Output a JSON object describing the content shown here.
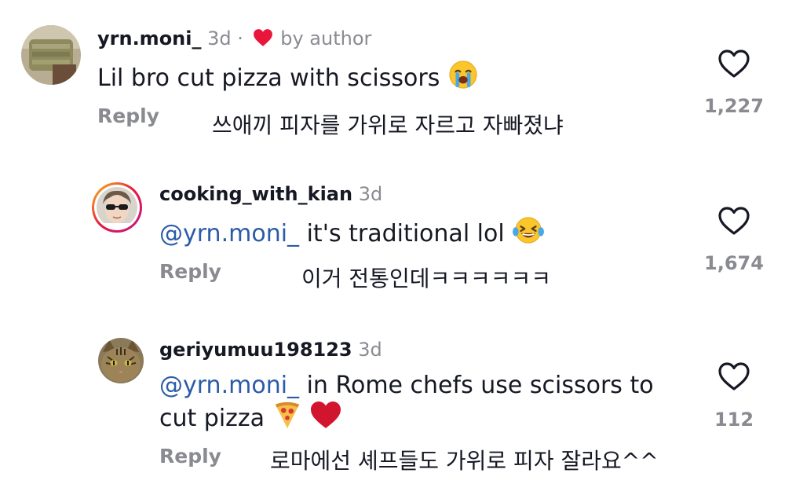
{
  "comments": [
    {
      "username": "yrn.moni_",
      "time": "3d",
      "separator": "·",
      "badge": "by author",
      "text": "Lil bro cut pizza with scissors",
      "emoji": "sob-emoji",
      "reply_label": "Reply",
      "translation": "쓰애끼 피자를 가위로 자르고 자빠졌냐",
      "likes": "1,227"
    },
    {
      "username": "cooking_with_kian",
      "time": "3d",
      "mention": "@yrn.moni_",
      "text": "it's traditional lol",
      "emoji": "laughing-tears-emoji",
      "reply_label": "Reply",
      "translation": "이거 전통인데ㅋㅋㅋㅋㅋㅋ",
      "likes": "1,674"
    },
    {
      "username": "geriyumuu198123",
      "time": "3d",
      "mention": "@yrn.moni_",
      "text_line1": "in Rome chefs use scissors to",
      "text_line2": "cut pizza",
      "emojis": [
        "pizza-emoji",
        "red-heart-emoji"
      ],
      "reply_label": "Reply",
      "translation": "로마에선 셰프들도 가위로 피자 잘라요^^",
      "likes": "112"
    }
  ],
  "colors": {
    "text": "#161823",
    "muted": "#8a8b91",
    "mention": "#2b5ba8",
    "heart_red": "#e8163b"
  }
}
